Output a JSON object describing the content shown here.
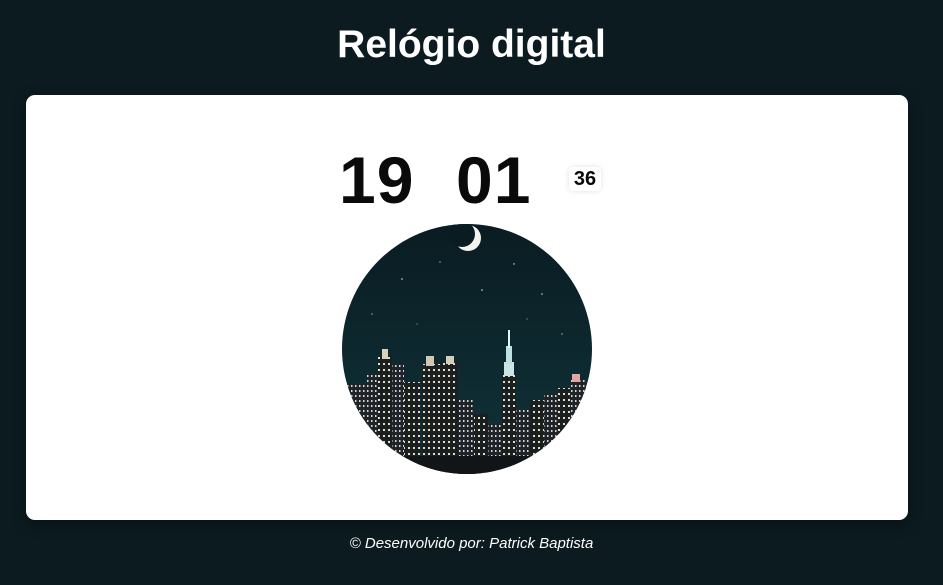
{
  "header": {
    "title": "Relógio digital"
  },
  "clock": {
    "hours": "19",
    "minutes": "01",
    "seconds": "36"
  },
  "image": {
    "icon": "night-city-skyline-with-moon"
  },
  "footer": {
    "credit": "© Desenvolvido por: Patrick Baptista"
  },
  "colors": {
    "background": "#0b1b1f",
    "card": "#ffffff",
    "text_dark": "#0a0a0a",
    "text_light": "#ffffff"
  }
}
